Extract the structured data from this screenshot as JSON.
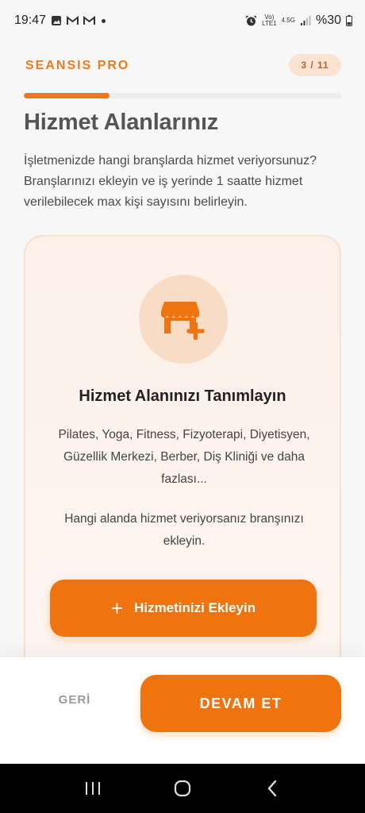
{
  "status_bar": {
    "time": "19:47",
    "network_top": "Vo)",
    "network_bottom": "LTE1",
    "net_type": "4.5G",
    "battery": "%30"
  },
  "header": {
    "brand": "SEANSIS PRO",
    "step": "3 / 11",
    "progress_fraction": 0.27
  },
  "main": {
    "title": "Hizmet Alanlarınız",
    "description": "İşletmenizde hangi branşlarda hizmet veriyorsunuz? Branşlarınızı ekleyin ve iş yerinde 1 saatte hizmet verilebilecek max kişi sayısını belirleyin."
  },
  "card": {
    "icon": "store-add-icon",
    "title": "Hizmet Alanınızı Tanımlayın",
    "examples": "Pilates, Yoga, Fitness, Fizyoterapi, Diyetisyen, Güzellik Merkezi, Berber, Diş Kliniği ve daha fazlası...",
    "hint": "Hangi alanda hizmet veriyorsanız branşınızı ekleyin.",
    "add_button_icon": "+",
    "add_button_label": "Hizmetinizi Ekleyin"
  },
  "footer": {
    "back_label": "GERİ",
    "continue_label": "DEVAM ET"
  },
  "colors": {
    "accent": "#ef740f",
    "accent_soft": "#f9dcc6",
    "card_border": "#fbe0cc"
  }
}
